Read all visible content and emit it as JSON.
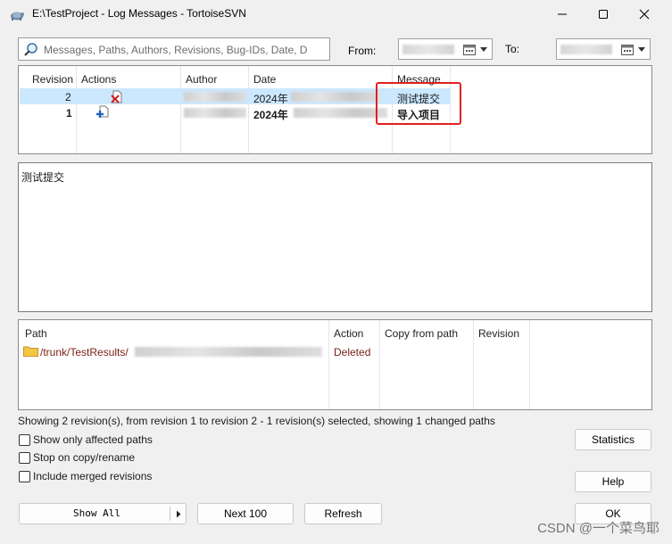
{
  "window": {
    "title": "E:\\TestProject - Log Messages - TortoiseSVN"
  },
  "filter": {
    "placeholder": "Messages, Paths, Authors, Revisions, Bug-IDs, Date, D",
    "from_label": "From:",
    "to_label": "To:"
  },
  "log_table": {
    "headers": [
      "Revision",
      "Actions",
      "Author",
      "Date",
      "Message"
    ],
    "rows": [
      {
        "revision": "2",
        "date": "2024年",
        "message": "测试提交",
        "action": "deleted",
        "selected": true,
        "bold": false
      },
      {
        "revision": "1",
        "date": "2024年",
        "message": "导入项目",
        "action": "added",
        "selected": false,
        "bold": true
      }
    ]
  },
  "message_pane": {
    "text": "测试提交"
  },
  "paths_table": {
    "headers": [
      "Path",
      "Action",
      "Copy from path",
      "Revision"
    ],
    "rows": [
      {
        "path": "/trunk/TestResults/",
        "action": "Deleted"
      }
    ]
  },
  "status_text": "Showing 2 revision(s), from revision 1 to revision 2 - 1 revision(s) selected, showing 1 changed paths",
  "options": {
    "show_only_affected_paths": "Show only affected paths",
    "stop_on_copy": "Stop on copy/rename",
    "include_merged": "Include merged revisions"
  },
  "buttons": {
    "show_all": "Show All",
    "next_100": "Next 100",
    "refresh": "Refresh",
    "statistics": "Statistics",
    "help": "Help",
    "ok": "OK"
  },
  "colors": {
    "selected_row": "#cce8ff",
    "path_text": "#7a1e12",
    "annotation": "#e02020"
  },
  "watermark": "CSDN @一个菜鸟耶"
}
